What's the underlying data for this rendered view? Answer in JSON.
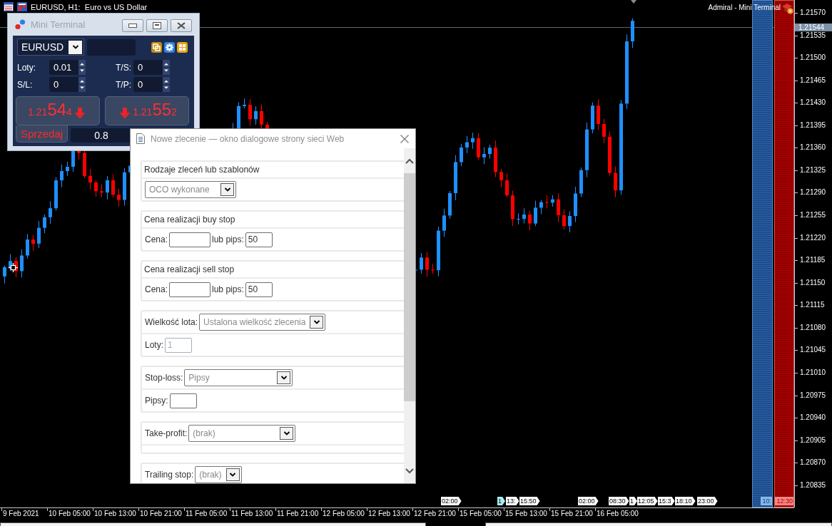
{
  "chart": {
    "title": "EURUSD, H1:  Euro vs US Dollar",
    "expert": "Admiral - Mini Terminal",
    "current_price": "1.21544",
    "price_axis": [
      "1.21570",
      "1.21535",
      "1.21500",
      "1.21465",
      "1.21430",
      "1.21395",
      "1.21360",
      "1.21325",
      "1.21290",
      "1.21255",
      "1.21220",
      "1.21185",
      "1.21150",
      "1.21115",
      "1.21080",
      "1.21045",
      "1.21010",
      "1.20975",
      "1.20940",
      "1.20905",
      "1.20870",
      "1.20835"
    ],
    "time_axis": [
      "9 Feb 2021",
      "10 Feb 05:00",
      "10 Feb 13:00",
      "10 Feb 21:00",
      "11 Feb 05:00",
      "11 Feb 13:00",
      "11 Feb 21:00",
      "12 Feb 05:00",
      "12 Feb 13:00",
      "12 Feb 21:00",
      "15 Feb 05:00",
      "15 Feb 13:00",
      "15 Feb 21:00",
      "16 Feb 05:00"
    ],
    "event_flags": [
      {
        "label": "02:00",
        "highlighted": false
      },
      {
        "label": "1",
        "highlighted": true
      },
      {
        "label": "13:",
        "highlighted": false
      },
      {
        "label": "15:50",
        "highlighted": false
      },
      {
        "label": "02:00",
        "highlighted": false
      },
      {
        "label": "08:30",
        "highlighted": false
      },
      {
        "label": "1",
        "highlighted": false
      },
      {
        "label": "12:05",
        "highlighted": false
      },
      {
        "label": "15:3",
        "highlighted": false
      },
      {
        "label": "18:10",
        "highlighted": false
      },
      {
        "label": "23:00",
        "highlighted": false
      }
    ],
    "depth_bars": [
      {
        "kind": "buy",
        "label": "10:"
      },
      {
        "kind": "sell",
        "label": "12:30"
      }
    ]
  },
  "mini_terminal": {
    "title": "Mini Terminal",
    "symbol": "EURUSD",
    "fields": [
      {
        "label": "Loty:",
        "value": "0.01"
      },
      {
        "label": "T/S:",
        "value": "0"
      },
      {
        "label": "S/L:",
        "value": "0"
      },
      {
        "label": "T/P:",
        "value": "0"
      }
    ],
    "prices": [
      {
        "kind": "sell",
        "head": "1.21",
        "big": "54",
        "tail": "4"
      },
      {
        "kind": "buy",
        "head": "1.21",
        "big": "55",
        "tail": "2"
      }
    ],
    "tab": "Sprzedaj",
    "volume": "0.8"
  },
  "dialog": {
    "title": "Nowe zlecenie — okno dialogowe strony sieci Web",
    "sections": [
      {
        "rows": [
          {
            "kind": "heading",
            "text": "Rodzaje zleceń lub szablonów"
          },
          {
            "kind": "controls",
            "controls": [
              {
                "kind": "select",
                "value": "OCO wykonane"
              }
            ]
          }
        ]
      },
      {
        "rows": [
          {
            "kind": "heading",
            "text": "Cena realizacji buy stop"
          },
          {
            "kind": "controls",
            "controls": [
              {
                "kind": "input",
                "label": "Cena:",
                "disabled": false
              },
              {
                "kind": "input",
                "label": "lub pips:",
                "value": "50",
                "disabled": false
              }
            ]
          }
        ]
      },
      {
        "rows": [
          {
            "kind": "heading",
            "text": "Cena realizacji sell stop"
          },
          {
            "kind": "controls",
            "controls": [
              {
                "kind": "input",
                "label": "Cena:",
                "disabled": false
              },
              {
                "kind": "input",
                "label": "lub pips:",
                "value": "50",
                "disabled": false
              }
            ]
          }
        ]
      },
      {
        "rows": [
          {
            "kind": "controls",
            "controls": [
              {
                "kind": "select",
                "label": "Wielkość lota:",
                "value": "Ustalona wielkość zlecenia"
              }
            ]
          },
          {
            "kind": "controls",
            "controls": [
              {
                "kind": "input",
                "label": "Loty:",
                "value": "1",
                "disabled": true
              }
            ]
          }
        ]
      },
      {
        "rows": [
          {
            "kind": "controls",
            "controls": [
              {
                "kind": "select",
                "label": "Stop-loss:",
                "value": "Pipsy"
              }
            ]
          },
          {
            "kind": "controls",
            "controls": [
              {
                "kind": "input",
                "label": "Pipsy:",
                "disabled": false
              }
            ]
          }
        ]
      },
      {
        "rows": [
          {
            "kind": "controls",
            "controls": [
              {
                "kind": "select",
                "label": "Take-profit:",
                "value": "(brak)"
              }
            ]
          },
          {
            "kind": "blank"
          }
        ]
      },
      {
        "rows": [
          {
            "kind": "controls",
            "controls": [
              {
                "kind": "select",
                "label": "Trailing stop:",
                "value": "(brak)"
              }
            ]
          }
        ]
      }
    ]
  }
}
